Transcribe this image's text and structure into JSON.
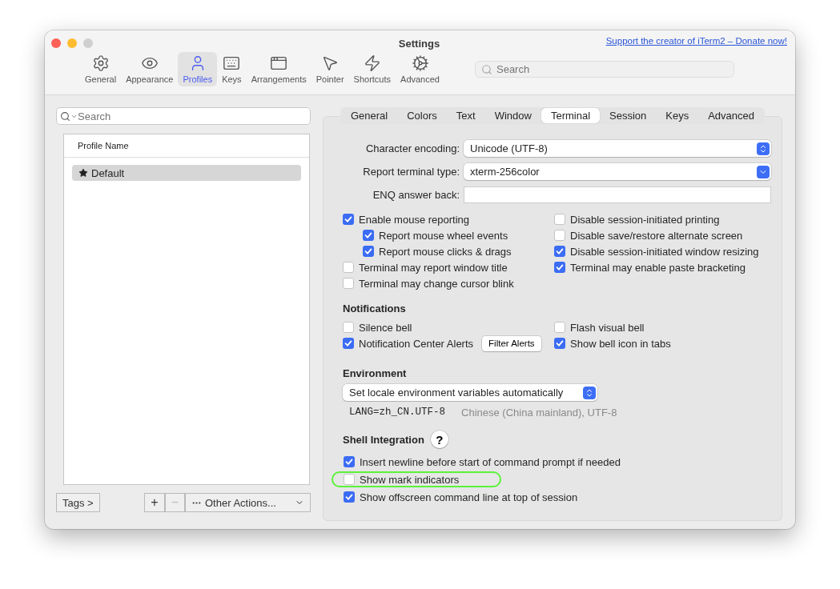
{
  "window": {
    "title": "Settings",
    "link": "Support the creator of iTerm2 – Donate now!"
  },
  "toolbar": {
    "items": [
      {
        "label": "General",
        "selected": false
      },
      {
        "label": "Appearance",
        "selected": false
      },
      {
        "label": "Profiles",
        "selected": true
      },
      {
        "label": "Keys",
        "selected": false
      },
      {
        "label": "Arrangements",
        "selected": false
      },
      {
        "label": "Pointer",
        "selected": false
      },
      {
        "label": "Shortcuts",
        "selected": false
      },
      {
        "label": "Advanced",
        "selected": false
      }
    ],
    "search": {
      "placeholder": "Search"
    }
  },
  "profiles": {
    "search": {
      "placeholder": "Search"
    },
    "column": "Profile Name",
    "rows": [
      {
        "name": "Default",
        "selected": true
      }
    ],
    "buttons": {
      "tags": "Tags >",
      "add": "+",
      "remove": "−",
      "remove_disabled": true,
      "other": "Other Actions..."
    }
  },
  "tabs": [
    {
      "label": "General",
      "selected": false
    },
    {
      "label": "Colors",
      "selected": false
    },
    {
      "label": "Text",
      "selected": false
    },
    {
      "label": "Window",
      "selected": false
    },
    {
      "label": "Terminal",
      "selected": true
    },
    {
      "label": "Session",
      "selected": false
    },
    {
      "label": "Keys",
      "selected": false
    },
    {
      "label": "Advanced",
      "selected": false
    }
  ],
  "emulation": {
    "fields": [
      {
        "label": "Character encoding:",
        "kind": "stepper",
        "value": "Unicode (UTF-8)"
      },
      {
        "label": "Report terminal type:",
        "kind": "dropdown",
        "value": "xterm-256color"
      },
      {
        "label": "ENQ answer back:",
        "kind": "text"
      }
    ],
    "left": [
      {
        "label": "Enable mouse reporting",
        "checked": true,
        "children": [
          {
            "label": "Report mouse wheel events",
            "checked": true
          },
          {
            "label": "Report mouse clicks & drags",
            "checked": true
          }
        ]
      },
      {
        "label": "Terminal may report window title",
        "checked": false
      },
      {
        "label": "Terminal may change cursor blink",
        "checked": false
      }
    ],
    "right": [
      {
        "label": "Disable session-initiated printing",
        "checked": false
      },
      {
        "label": "Disable save/restore alternate screen",
        "checked": false
      },
      {
        "label": "Disable session-initiated window resizing",
        "checked": true
      },
      {
        "label": "Terminal may enable paste bracketing",
        "checked": true
      }
    ]
  },
  "notifications": {
    "title": "Notifications",
    "left": [
      {
        "label": "Silence bell",
        "checked": false
      },
      {
        "label": "Notification Center Alerts",
        "checked": true,
        "button": "Filter Alerts"
      }
    ],
    "right": [
      {
        "label": "Flash visual bell",
        "checked": false
      },
      {
        "label": "Show bell icon in tabs",
        "checked": true
      }
    ]
  },
  "environment": {
    "title": "Environment",
    "value": "Set locale environment variables automatically",
    "lang": "LANG=zh_CN.UTF-8",
    "description": "Chinese (China mainland), UTF-8"
  },
  "shell_integration": {
    "title": "Shell Integration",
    "help": "?",
    "options": [
      {
        "label": "Insert newline before start of command prompt if needed",
        "checked": true,
        "highlighted": false
      },
      {
        "label": "Show mark indicators",
        "checked": false,
        "highlighted": true
      },
      {
        "label": "Show offscreen command line at top of session",
        "checked": true,
        "highlighted": false
      }
    ]
  }
}
